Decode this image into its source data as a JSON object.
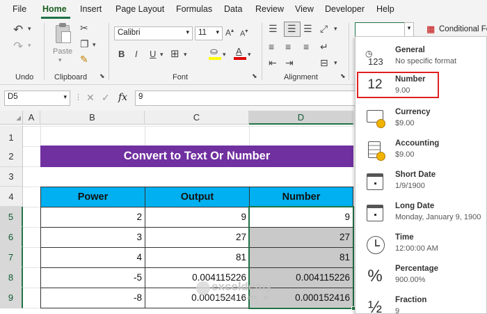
{
  "menu": {
    "tabs": [
      "File",
      "Home",
      "Insert",
      "Page Layout",
      "Formulas",
      "Data",
      "Review",
      "View",
      "Developer",
      "Help"
    ],
    "active": "Home"
  },
  "ribbon": {
    "groups": {
      "undo": "Undo",
      "clipboard": "Clipboard",
      "font": "Font",
      "alignment": "Alignment"
    },
    "paste_label": "Paste",
    "font_name": "Calibri",
    "font_size": "11",
    "conditional_formatting": "Conditional Fo",
    "number_format_value": ""
  },
  "formula_bar": {
    "name_box": "D5",
    "fx": "fx",
    "value": "9"
  },
  "sheet": {
    "columns": [
      "A",
      "B",
      "C",
      "D"
    ],
    "rows": [
      "1",
      "2",
      "3",
      "4",
      "5",
      "6",
      "7",
      "8",
      "9"
    ],
    "title": "Convert to Text Or Number",
    "headers": [
      "Power",
      "Output",
      "Number"
    ],
    "data": [
      [
        "2",
        "9",
        "9"
      ],
      [
        "3",
        "27",
        "27"
      ],
      [
        "4",
        "81",
        "81"
      ],
      [
        "-5",
        "0.004115226",
        "0.004115226"
      ],
      [
        "-8",
        "0.000152416",
        "0.000152416"
      ]
    ]
  },
  "watermark": {
    "name": "exceldemy",
    "tagline": "EXCEL · DATA · BI"
  },
  "number_format_menu": [
    {
      "name": "General",
      "sample": "No specific format",
      "icon": "general-123-icon"
    },
    {
      "name": "Number",
      "sample": "9.00",
      "icon": "number-12-icon",
      "highlighted": true
    },
    {
      "name": "Currency",
      "sample": "$9.00",
      "icon": "currency-icon"
    },
    {
      "name": "Accounting",
      "sample": " $9.00",
      "icon": "accounting-icon"
    },
    {
      "name": "Short Date",
      "sample": "1/9/1900",
      "icon": "calendar-icon"
    },
    {
      "name": "Long Date",
      "sample": "Monday, January 9, 1900",
      "icon": "calendar-icon"
    },
    {
      "name": "Time",
      "sample": "12:00:00 AM",
      "icon": "clock-icon"
    },
    {
      "name": "Percentage",
      "sample": "900.00%",
      "icon": "percent-icon"
    },
    {
      "name": "Fraction",
      "sample": "9",
      "icon": "fraction-icon"
    }
  ],
  "colors": {
    "accent": "#217346",
    "title_bg": "#7030a0",
    "header_bg": "#00b0f0",
    "highlight_border": "#e02020",
    "grey_fill": "#c9c9c9"
  },
  "fmt_icon_text": {
    "general": "123",
    "number": "12",
    "percent": "%",
    "fraction": "½"
  }
}
